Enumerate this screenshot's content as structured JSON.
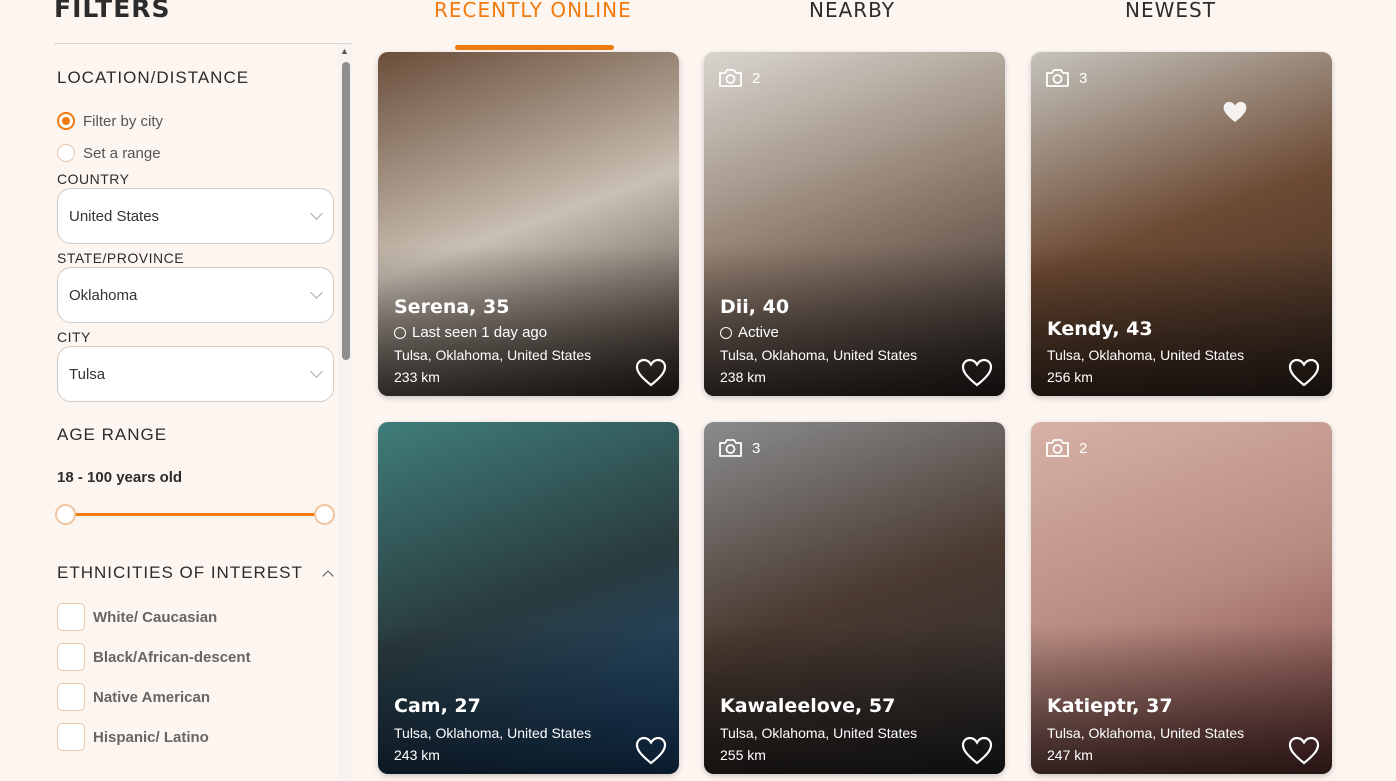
{
  "sidebar": {
    "title": "FILTERS",
    "location": {
      "title": "LOCATION/DISTANCE",
      "options": [
        "Filter by city",
        "Set a range"
      ],
      "selected": "Filter by city",
      "country": {
        "label": "COUNTRY",
        "value": "United States"
      },
      "state": {
        "label": "STATE/PROVINCE",
        "value": "Oklahoma"
      },
      "city": {
        "label": "CITY",
        "value": "Tulsa"
      }
    },
    "age": {
      "title": "AGE RANGE",
      "value": "18 - 100 years old",
      "min": 18,
      "max": 100
    },
    "ethnicities": {
      "title": "ETHNICITIES OF INTEREST",
      "items": [
        "White/ Caucasian",
        "Black/African-descent",
        "Native American",
        "Hispanic/ Latino"
      ]
    }
  },
  "tabs": [
    {
      "label": "RECENTLY ONLINE",
      "active": true
    },
    {
      "label": "NEARBY",
      "active": false
    },
    {
      "label": "NEWEST",
      "active": false
    }
  ],
  "cards": [
    {
      "name": "Serena, 35",
      "status": "Last seen 1 day ago",
      "location": "Tulsa, Oklahoma, United States",
      "distance": "233 km",
      "photos": "",
      "favorited": false,
      "bg": [
        "#6a4e3a",
        "#c9bfb3",
        "#3a2e28"
      ]
    },
    {
      "name": "Dii, 40",
      "status": "Active",
      "location": "Tulsa, Oklahoma, United States",
      "distance": "238 km",
      "photos": "2",
      "favorited": false,
      "bg": [
        "#d9d6cf",
        "#8d7a6c",
        "#2b2422"
      ]
    },
    {
      "name": "Kendy, 43",
      "status": "",
      "location": "Tulsa, Oklahoma, United States",
      "distance": "256 km",
      "photos": "3",
      "favorited": true,
      "bg": [
        "#c5c3bd",
        "#6c4a33",
        "#3a2b22"
      ]
    },
    {
      "name": "Cam, 27",
      "status": "",
      "location": "Tulsa, Oklahoma, United States",
      "distance": "243 km",
      "photos": "",
      "favorited": false,
      "bg": [
        "#3f7d7a",
        "#2a3b3e",
        "#1e4d80"
      ]
    },
    {
      "name": "Kawaleelove, 57",
      "status": "",
      "location": "Tulsa, Oklahoma, United States",
      "distance": "255 km",
      "photos": "3",
      "favorited": false,
      "bg": [
        "#8a8c8e",
        "#4a3a30",
        "#2a2a2c"
      ]
    },
    {
      "name": "Katieptr, 37",
      "status": "",
      "location": "Tulsa, Oklahoma, United States",
      "distance": "247 km",
      "photos": "2",
      "favorited": false,
      "bg": [
        "#d7b1a6",
        "#b78a80",
        "#6e3a38"
      ]
    }
  ],
  "colors": {
    "accent": "#f07b0f",
    "background": "#fdf5f0"
  }
}
